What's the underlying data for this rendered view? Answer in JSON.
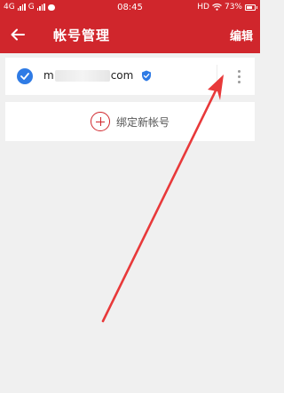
{
  "status_bar": {
    "left_text": "4G",
    "left_text2": "G",
    "time": "08:45",
    "right_text": "HD",
    "battery": "73%"
  },
  "app_bar": {
    "title": "帐号管理",
    "edit_label": "编辑"
  },
  "account": {
    "email_prefix": "m",
    "email_suffix": "com",
    "selected": true,
    "verified": true
  },
  "bind_new": {
    "label": "绑定新帐号"
  },
  "colors": {
    "brand_red": "#d0262c",
    "check_blue": "#2f7be5",
    "arrow_red": "#e8393a"
  }
}
